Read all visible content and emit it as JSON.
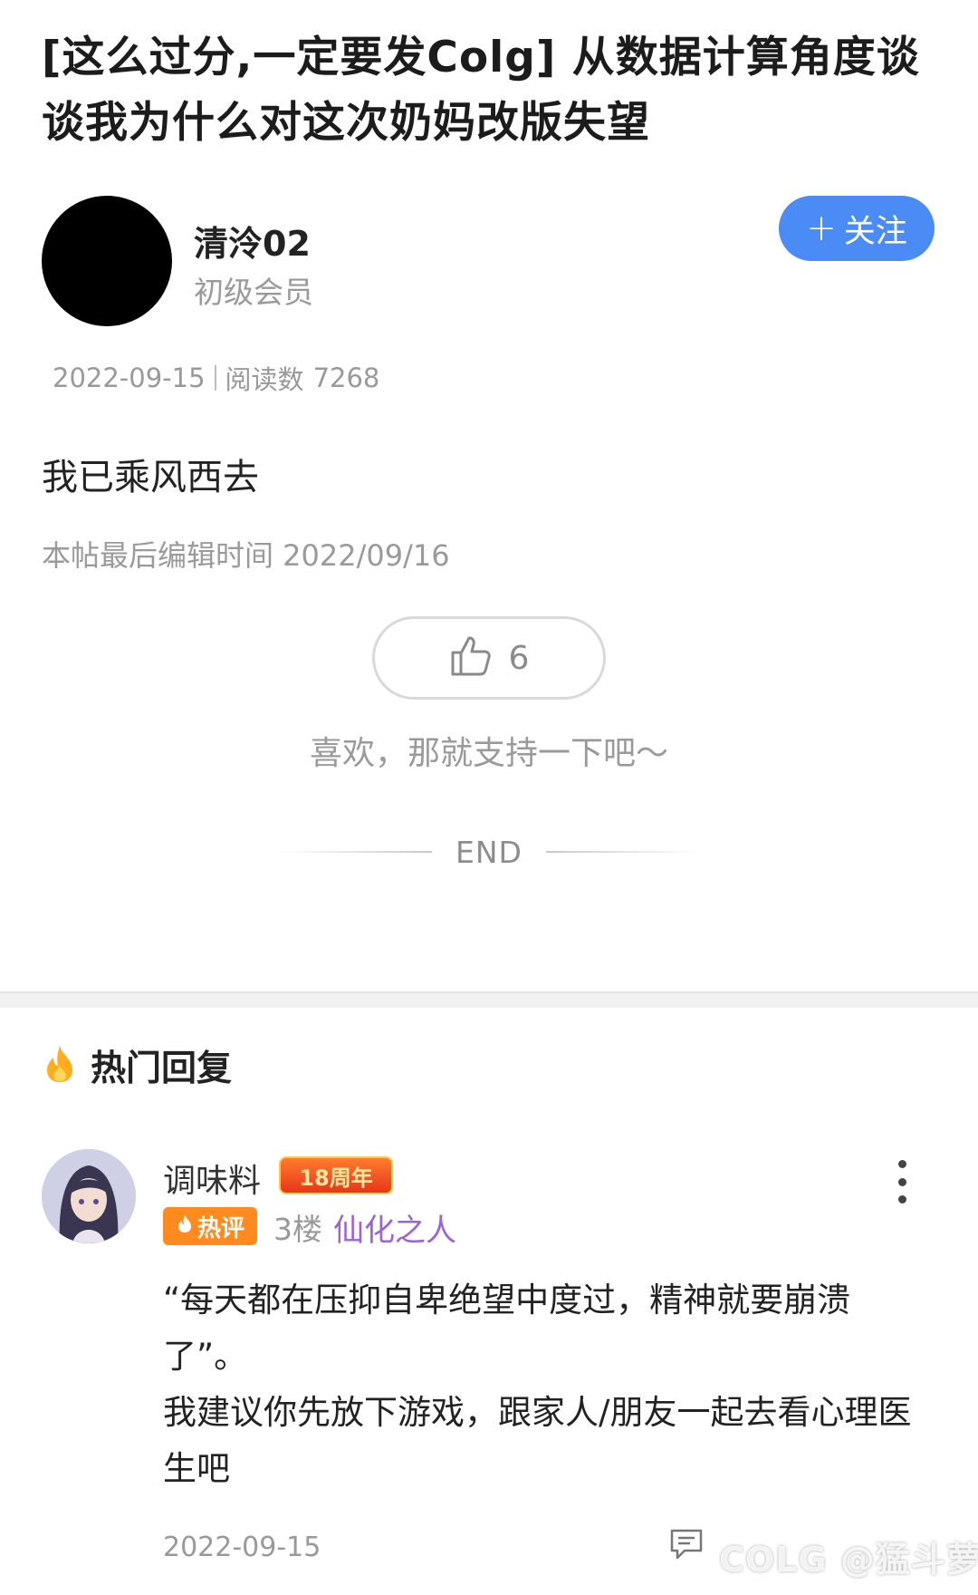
{
  "post": {
    "title": "[这么过分,一定要发Colg] 从数据计算角度谈谈我为什么对这次奶妈改版失望",
    "author": {
      "name": "清泠02",
      "rank": "初级会员"
    },
    "follow_label": "关注",
    "follow_plus": "+",
    "date": "2022-09-15",
    "read_label": "阅读数",
    "read_count": "7268",
    "body": "我已乘风西去",
    "edit_note": "本帖最后编辑时间 2022/09/16",
    "like_count": "6",
    "like_hint": "喜欢，那就支持一下吧～",
    "end_text": "END"
  },
  "hot_replies": {
    "title": "热门回复",
    "items": [
      {
        "user": "调味料",
        "badge": "18周年",
        "hot_tag": "热评",
        "floor": "3楼",
        "user_title": "仙化之人",
        "text": "“每天都在压抑自卑绝望中度过，精神就要崩溃了”。\n我建议你先放下游戏，跟家人/朋友一起去看心理医生吧",
        "date": "2022-09-15"
      }
    ]
  },
  "watermark": "COLG @猛斗萝",
  "colors": {
    "accent_blue": "#4b8bf5",
    "hot_orange": "#ff8a1f",
    "title_purple": "#9b62d9"
  },
  "icons": {
    "like": "thumbs-up-icon",
    "hot": "flame-icon",
    "more": "more-vertical-icon",
    "comment": "comment-icon"
  }
}
